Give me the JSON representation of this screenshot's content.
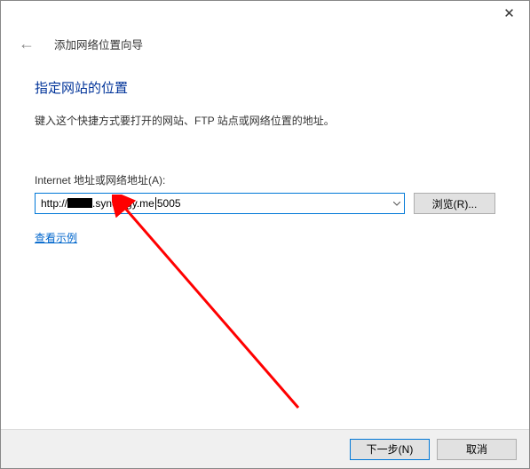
{
  "titlebar": {
    "close": "✕"
  },
  "header": {
    "back": "←",
    "wizard_title": "添加网络位置向导"
  },
  "page": {
    "heading": "指定网站的位置",
    "instruction": "键入这个快捷方式要打开的网站、FTP 站点或网络位置的地址。",
    "field_label": "Internet 地址或网络地址(A):",
    "url_prefix": "http://",
    "url_mid": ".synology.me",
    "url_suffix": "5005",
    "browse_label": "浏览(R)...",
    "example_link": "查看示例"
  },
  "footer": {
    "next": "下一步(N)",
    "cancel": "取消"
  }
}
